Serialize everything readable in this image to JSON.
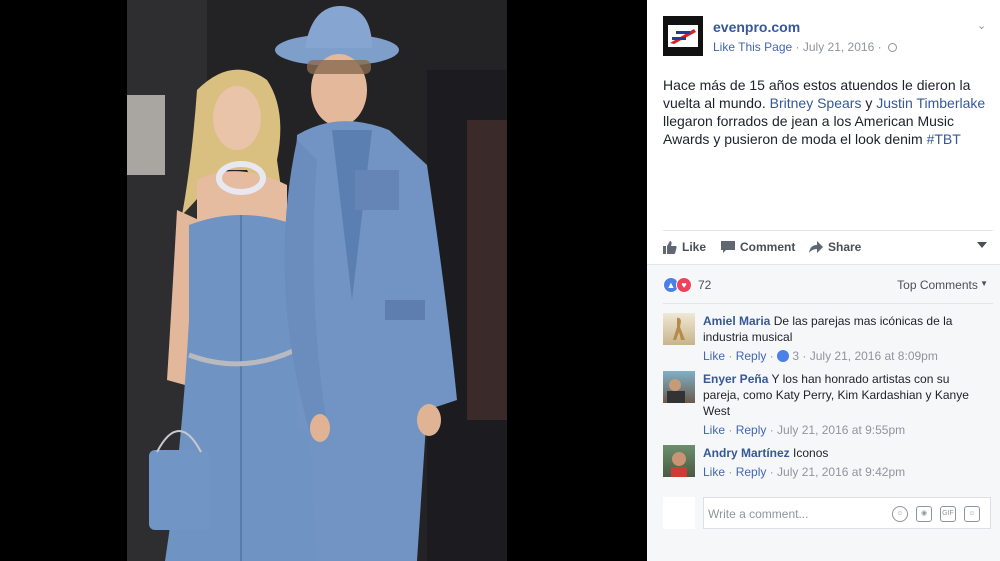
{
  "post": {
    "page_name": "evenpro.com",
    "like_page": "Like This Page",
    "date": "July 21, 2016",
    "text": {
      "part1": "Hace más de 15 años estos atuendos le dieron la vuelta al mundo.",
      "mention1": "Britney Spears",
      "and": "y",
      "mention2": "Justin Timberlake",
      "part2": "llegaron forrados de jean a los American Music Awards y pusieron de moda el look denim",
      "hashtag": "#TBT"
    }
  },
  "actions": {
    "like": "Like",
    "comment": "Comment",
    "share": "Share"
  },
  "reactions": {
    "count": "72",
    "top_comments": "Top Comments"
  },
  "comments": [
    {
      "name": "Amiel Maria",
      "text": "De las parejas mas icónicas de la industria musical",
      "like": "Like",
      "reply": "Reply",
      "likes": "3",
      "time": "July 21, 2016 at 8:09pm"
    },
    {
      "name": "Enyer Peña",
      "text": "Y los han honrado artistas con su pareja, como Katy Perry, Kim Kardashian y Kanye West",
      "like": "Like",
      "reply": "Reply",
      "time": "July 21, 2016 at 9:55pm"
    },
    {
      "name": "Andry Martínez",
      "text": "Iconos",
      "like": "Like",
      "reply": "Reply",
      "time": "July 21, 2016 at 9:42pm"
    }
  ],
  "compose": {
    "placeholder": "Write a comment..."
  },
  "colors": {
    "link": "#365899",
    "denim": "#6f93c2",
    "panel_bg": "#f6f7f9"
  }
}
